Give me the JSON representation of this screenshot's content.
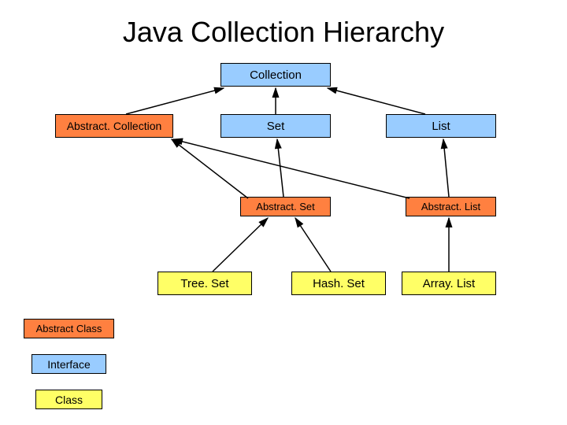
{
  "title": "Java Collection Hierarchy",
  "nodes": {
    "collection": "Collection",
    "abstractCollection": "Abstract. Collection",
    "set": "Set",
    "list": "List",
    "abstractSet": "Abstract. Set",
    "abstractList": "Abstract. List",
    "treeSet": "Tree. Set",
    "hashSet": "Hash. Set",
    "arrayList": "Array. List"
  },
  "legend": {
    "abstract": "Abstract Class",
    "interface": "Interface",
    "class": "Class"
  },
  "colors": {
    "interface": "#99ccff",
    "abstract": "#ff8040",
    "class": "#ffff66"
  }
}
